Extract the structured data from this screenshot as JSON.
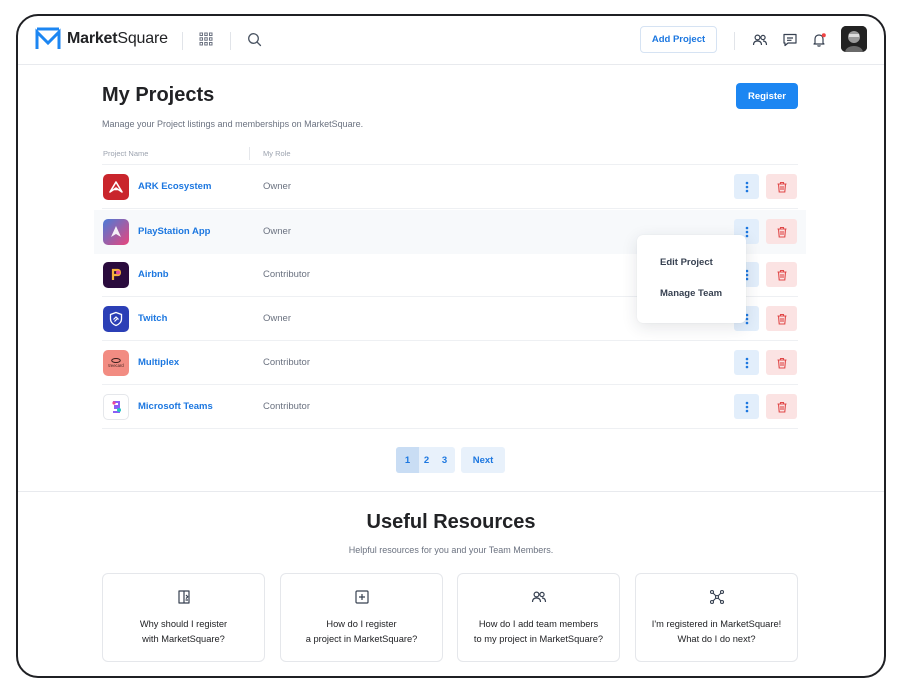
{
  "brand": {
    "name_bold": "Market",
    "name_rest": "Square"
  },
  "header": {
    "add_project_label": "Add Project"
  },
  "projects": {
    "title": "My Projects",
    "subtitle": "Manage your Project listings and memberships on MarketSquare.",
    "register_label": "Register",
    "columns": {
      "name": "Project Name",
      "role": "My Role"
    },
    "rows": [
      {
        "name": "ARK Ecosystem",
        "role": "Owner"
      },
      {
        "name": "PlayStation App",
        "role": "Owner"
      },
      {
        "name": "Airbnb",
        "role": "Contributor"
      },
      {
        "name": "Twitch",
        "role": "Owner"
      },
      {
        "name": "Multiplex",
        "role": "Contributor",
        "logo_text": "treecard"
      },
      {
        "name": "Microsoft Teams",
        "role": "Contributor"
      }
    ],
    "menu": {
      "edit": "Edit Project",
      "team": "Manage Team"
    }
  },
  "pagination": {
    "pages": [
      "1",
      "2",
      "3"
    ],
    "current": "1",
    "next_label": "Next"
  },
  "resources": {
    "title": "Useful Resources",
    "subtitle": "Helpful resources for you and your Team Members.",
    "cards": [
      {
        "icon": "register-icon",
        "text": "Why should I register\nwith MarketSquare?"
      },
      {
        "icon": "plus-square-icon",
        "text": "How do I register\na project in MarketSquare?"
      },
      {
        "icon": "users-icon",
        "text": "How do I add team members\nto my project in MarketSquare?"
      },
      {
        "icon": "network-icon",
        "text": "I'm registered in MarketSquare!\nWhat do I do next?"
      }
    ]
  },
  "colors": {
    "accent": "#1c86f2",
    "link": "#1c77e0",
    "danger_bg": "#fbe3e3",
    "notification": "#ef4444"
  }
}
